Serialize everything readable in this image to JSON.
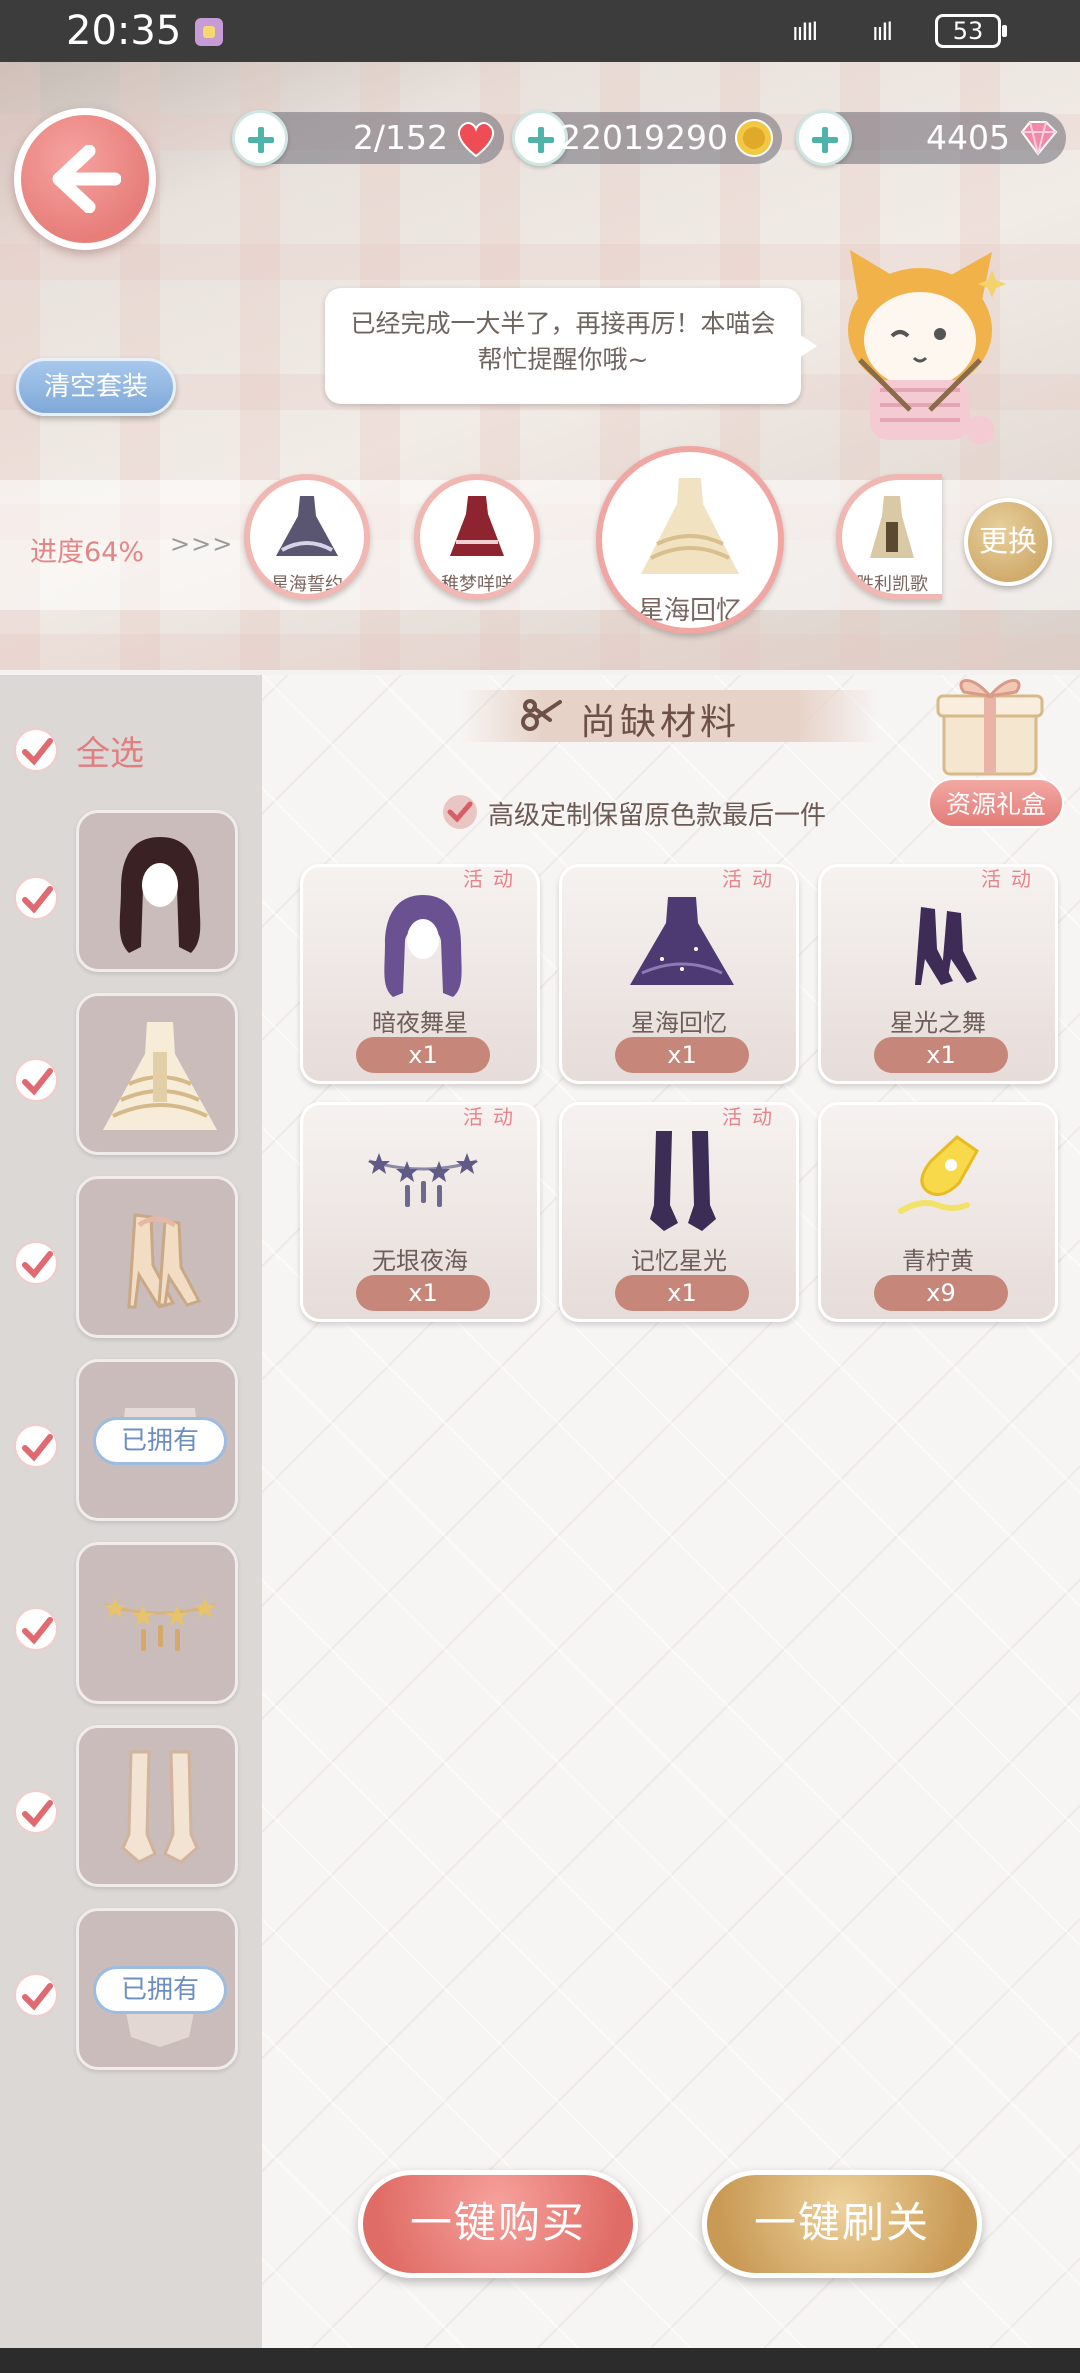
{
  "status_bar": {
    "time": "20:35",
    "signal_1": "ııIIl",
    "signal_2": "ııIl",
    "battery": "53"
  },
  "resources": {
    "stamina": "2/152",
    "gold": "22019290",
    "diamond": "4405"
  },
  "top": {
    "clear_button": "清空套装",
    "bubble_text": "已经完成一大半了，再接再厉！本喵会帮忙提醒你哦~",
    "progress": "进度64%",
    "arrows": ">>>",
    "change_button": "更换"
  },
  "suits": [
    {
      "label": "星海誓约"
    },
    {
      "label": "稚梦咩咩"
    },
    {
      "label": "星海回忆"
    },
    {
      "label": "胜利凯歌"
    }
  ],
  "left": {
    "select_all": "全选",
    "owned_badge": "已拥有",
    "slots": [
      {
        "item": "hair-icon",
        "owned": false
      },
      {
        "item": "dress-icon",
        "owned": false
      },
      {
        "item": "shoes-icon",
        "owned": false
      },
      {
        "item": "coat-icon",
        "owned": true
      },
      {
        "item": "necklace-icon",
        "owned": false
      },
      {
        "item": "gloves-icon",
        "owned": false
      },
      {
        "item": "accessory-icon",
        "owned": true
      }
    ]
  },
  "panel": {
    "title": "尚缺材料",
    "gift_button": "资源礼盒",
    "keep_option": "高级定制保留原色款最后一件",
    "event_tag": "活动"
  },
  "materials": [
    {
      "name": "暗夜舞星",
      "qty": "x1",
      "tag": true,
      "icon": "hair-icon"
    },
    {
      "name": "星海回忆",
      "qty": "x1",
      "tag": true,
      "icon": "dress-icon"
    },
    {
      "name": "星光之舞",
      "qty": "x1",
      "tag": true,
      "icon": "shoes-icon"
    },
    {
      "name": "无垠夜海",
      "qty": "x1",
      "tag": true,
      "icon": "necklace-icon"
    },
    {
      "name": "记忆星光",
      "qty": "x1",
      "tag": true,
      "icon": "gloves-icon"
    },
    {
      "name": "青柠黄",
      "qty": "x9",
      "tag": false,
      "icon": "dye-bottle-icon"
    }
  ],
  "buttons": {
    "buy_all": "一键购买",
    "sweep_all": "一键刷关"
  },
  "colors": {
    "accent_pink": "#e77e7a",
    "accent_gold": "#c99a55",
    "accent_blue": "#7fa8d8"
  }
}
